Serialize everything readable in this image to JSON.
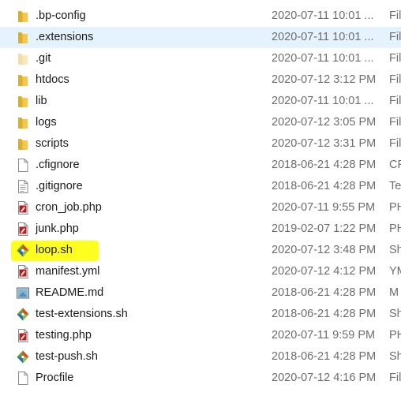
{
  "colors": {
    "selected_row": "#e5f3ff",
    "highlight": "#ffff1f",
    "folder": "#f2c94a",
    "meta_text": "#6d6d6d"
  },
  "files": [
    {
      "name": ".bp-config",
      "date": "2020-07-11 10:01 ...",
      "type": "Fil",
      "icon": "folder-icon"
    },
    {
      "name": ".extensions",
      "date": "2020-07-11 10:01 ...",
      "type": "Fil",
      "icon": "folder-icon",
      "selected": true
    },
    {
      "name": ".git",
      "date": "2020-07-11 10:01 ...",
      "type": "Fil",
      "icon": "folder-faded-icon"
    },
    {
      "name": "htdocs",
      "date": "2020-07-12 3:12 PM",
      "type": "Fil",
      "icon": "folder-icon"
    },
    {
      "name": "lib",
      "date": "2020-07-11 10:01 ...",
      "type": "Fil",
      "icon": "folder-icon"
    },
    {
      "name": "logs",
      "date": "2020-07-12 3:05 PM",
      "type": "Fil",
      "icon": "folder-icon"
    },
    {
      "name": "scripts",
      "date": "2020-07-12 3:31 PM",
      "type": "Fil",
      "icon": "folder-icon"
    },
    {
      "name": ".cfignore",
      "date": "2018-06-21 4:28 PM",
      "type": "CF",
      "icon": "blank-file-icon"
    },
    {
      "name": ".gitignore",
      "date": "2018-06-21 4:28 PM",
      "type": "Te",
      "icon": "text-file-icon"
    },
    {
      "name": "cron_job.php",
      "date": "2020-07-11 9:55 PM",
      "type": "PH",
      "icon": "php-file-icon"
    },
    {
      "name": "junk.php",
      "date": "2019-02-07 1:22 PM",
      "type": "PH",
      "icon": "php-file-icon"
    },
    {
      "name": "loop.sh",
      "date": "2020-07-12 3:48 PM",
      "type": "Sh",
      "icon": "git-shell-icon",
      "highlighted": true
    },
    {
      "name": "manifest.yml",
      "date": "2020-07-12 4:12 PM",
      "type": "YM",
      "icon": "php-file-icon"
    },
    {
      "name": "README.md",
      "date": "2018-06-21 4:28 PM",
      "type": "M",
      "icon": "markdown-file-icon"
    },
    {
      "name": "test-extensions.sh",
      "date": "2018-06-21 4:28 PM",
      "type": "Sh",
      "icon": "git-shell-icon"
    },
    {
      "name": "testing.php",
      "date": "2020-07-11 9:59 PM",
      "type": "PH",
      "icon": "php-file-icon"
    },
    {
      "name": "test-push.sh",
      "date": "2018-06-21 4:28 PM",
      "type": "Sh",
      "icon": "git-shell-icon"
    },
    {
      "name": "Procfile",
      "date": "2020-07-12 4:16 PM",
      "type": "Fil",
      "icon": "blank-file-icon"
    }
  ]
}
